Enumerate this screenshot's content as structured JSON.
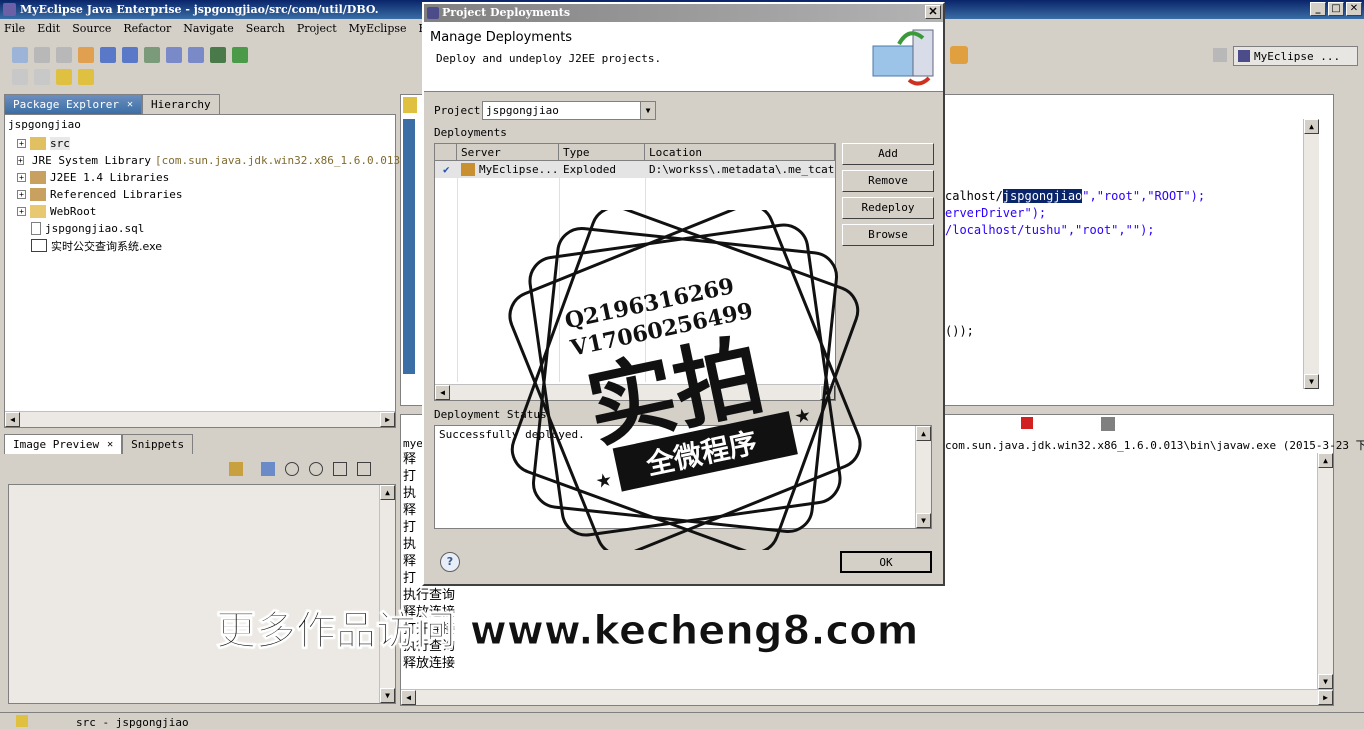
{
  "window": {
    "title": "MyEclipse Java Enterprise - jspgongjiao/src/com/util/DBO.",
    "controls": [
      "_",
      "□",
      "✕"
    ]
  },
  "menu": [
    "File",
    "Edit",
    "Source",
    "Refactor",
    "Navigate",
    "Search",
    "Project",
    "MyEclipse",
    "R"
  ],
  "perspective": {
    "label": "MyEclipse ..."
  },
  "package_explorer": {
    "tabs": [
      {
        "label": "Package Explorer",
        "close": "✕"
      },
      {
        "label": "Hierarchy"
      }
    ],
    "project_name": "jspgongjiao",
    "tree": [
      {
        "label": "src",
        "expander": "+"
      },
      {
        "label": "JRE System Library",
        "suffix": "[com.sun.java.jdk.win32.x86_1.6.0.013]",
        "expander": "+"
      },
      {
        "label": "J2EE 1.4 Libraries",
        "expander": "+"
      },
      {
        "label": "Referenced Libraries",
        "expander": "+"
      },
      {
        "label": "WebRoot",
        "expander": "+"
      },
      {
        "label": "jspgongjiao.sql"
      },
      {
        "label": "实时公交查询系统.exe"
      }
    ]
  },
  "image_preview": {
    "tabs": [
      {
        "label": "Image Preview",
        "close": "✕"
      },
      {
        "label": "Snippets"
      }
    ]
  },
  "editor": {
    "lines": [
      {
        "prefix": "calhost/",
        "selected": "jspgongjiao",
        "suffix": "\",\"root\",\"ROOT\");"
      },
      {
        "prefix": "erverDriver\");",
        "selected": "",
        "suffix": ""
      },
      {
        "prefix": "/localhost/tushu\",\"root\",\"\");",
        "selected": "",
        "suffix": ""
      },
      {
        "prefix": "());",
        "selected": "",
        "suffix": ""
      }
    ]
  },
  "console": {
    "header": "com.sun.java.jdk.win32.x86_1.6.0.013\\bin\\javaw.exe (2015-3-23 下",
    "prefix": "mye",
    "lines": [
      "释",
      "打",
      "执",
      "释",
      "打",
      "执",
      "释",
      "打",
      "执行查询",
      "释放连接",
      "打开连接",
      "执行查询",
      "释放连接"
    ]
  },
  "dialog": {
    "title": "Project Deployments",
    "heading": "Manage Deployments",
    "description": "Deploy and undeploy J2EE projects.",
    "project_label": "Project",
    "project_value": "jspgongjiao",
    "deployments_label": "Deployments",
    "columns": [
      "Server",
      "Type",
      "Location"
    ],
    "rows": [
      {
        "server": "MyEclipse...",
        "type": "Exploded",
        "location": "D:\\workss\\.metadata\\.me_tcat\\we"
      }
    ],
    "buttons": {
      "add": "Add",
      "remove": "Remove",
      "redeploy": "Redeploy",
      "browse": "Browse",
      "ok": "OK"
    },
    "status_label": "Deployment Status",
    "status_text": "Successfully deployed.",
    "help": "?"
  },
  "stamp": {
    "line1": "Q2196316269",
    "line2": "V17060256499",
    "big": "实拍",
    "banner": "全微程序"
  },
  "watermark": "更多作品访问 www.kecheng8.com",
  "statusbar": {
    "text": "src - jspgongjiao"
  },
  "colors": {
    "title_active": "#0a246a",
    "chrome": "#d4d0c8",
    "selection": "#0a246a",
    "string": "#2a00ff",
    "stamp": "#111111"
  }
}
